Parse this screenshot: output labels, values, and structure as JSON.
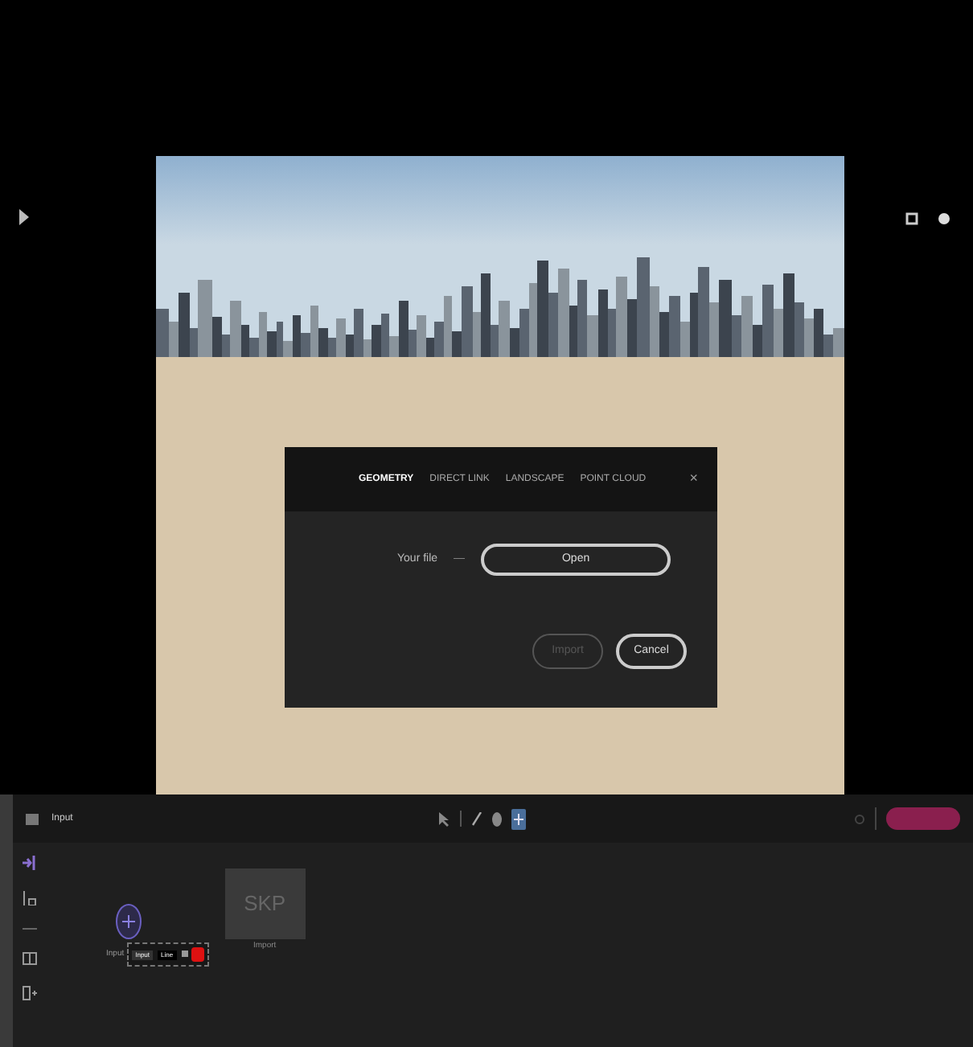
{
  "dialog": {
    "tabs": [
      {
        "label": "GEOMETRY",
        "selected": true
      },
      {
        "label": "DIRECT LINK",
        "selected": false
      },
      {
        "label": "LANDSCAPE",
        "selected": false
      },
      {
        "label": "POINT CLOUD",
        "selected": false
      }
    ],
    "close": "×",
    "file_label": "Your file",
    "file_separator": "—",
    "open_button": "Open",
    "buttons": [
      {
        "label": "Import",
        "disabled": true
      },
      {
        "label": "Cancel",
        "disabled": false
      }
    ]
  },
  "toolbar": {
    "title": "Input"
  },
  "canvas": {
    "node": {
      "label": "SKP",
      "caption": "Import"
    },
    "input_label": "Input",
    "popup": [
      "Input",
      "Line"
    ]
  }
}
